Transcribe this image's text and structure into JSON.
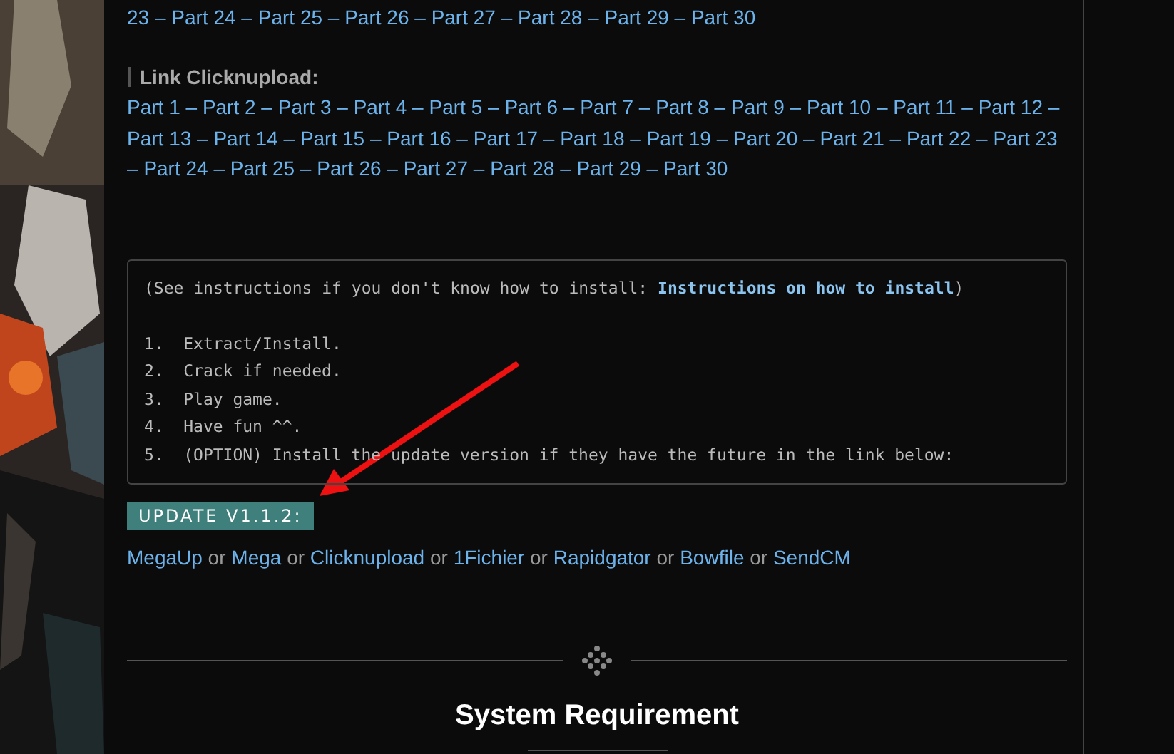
{
  "previous_links": [
    "23",
    "–",
    "Part 24",
    "–",
    "Part 25",
    "–",
    "Part 26",
    "–",
    "Part 27",
    "–",
    "Part 28",
    "–",
    "Part 29",
    "–",
    "Part 30"
  ],
  "clicknupload": {
    "heading": "Link Clicknupload:",
    "parts": [
      "Part 1",
      "–",
      "Part 2",
      "–",
      "Part 3",
      "–",
      "Part 4",
      "–",
      "Part 5",
      "–",
      "Part 6",
      "–",
      "Part 7",
      "–",
      "Part 8",
      "–",
      "Part 9",
      "–",
      "Part 10",
      "–",
      "Part 11",
      "–",
      "Part 12",
      "–",
      "Part 13",
      "–",
      "Part 14",
      "–",
      "Part 15",
      "–",
      "Part 16",
      "–",
      "Part 17",
      "–",
      "Part 18",
      "–",
      "Part 19",
      "–",
      "Part 20",
      "–",
      "Part 21",
      "–",
      "Part 22",
      "–",
      "Part 23",
      "–",
      "Part 24",
      "–",
      "Part 25",
      "–",
      "Part 26",
      "–",
      "Part 27",
      "–",
      "Part 28",
      "–",
      "Part 29",
      "–",
      "Part 30"
    ]
  },
  "instructions": {
    "intro_before": "(See instructions if you don't know how to install: ",
    "intro_link": "Instructions on how to install",
    "intro_after": ")",
    "steps": [
      {
        "number": "1.",
        "text": "Extract/Install."
      },
      {
        "number": "2.",
        "text": "Crack if needed."
      },
      {
        "number": "3.",
        "text": "Play game."
      },
      {
        "number": "4.",
        "text": "Have fun ^^."
      },
      {
        "number": "5.",
        "text": "(OPTION) Install the update version if they have the future in the link below:"
      }
    ]
  },
  "update": {
    "badge": "UPDATE V1.1.2:",
    "hosts": [
      "MegaUp",
      "or",
      "Mega",
      "or",
      "Clicknupload",
      "or",
      "1Fichier",
      "or",
      "Rapidgator",
      "or",
      "Bowfile",
      "or",
      "SendCM"
    ]
  },
  "section_title": "System Requirement"
}
